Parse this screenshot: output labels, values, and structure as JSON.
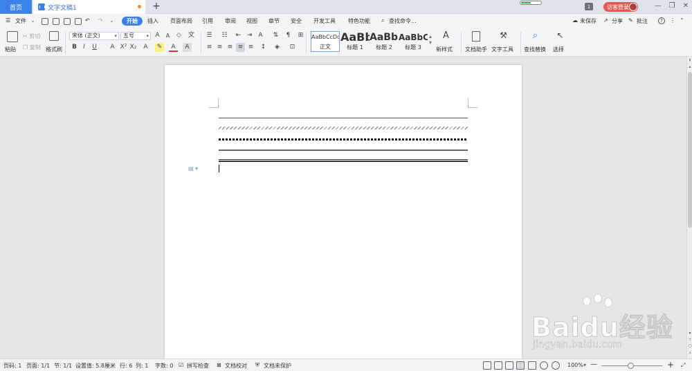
{
  "tabs": {
    "home": "首页",
    "doc": "文字文稿1",
    "add": "+"
  },
  "titlebar": {
    "badge": "1",
    "visitor": "访客登录",
    "minimize": "—",
    "restore": "❐",
    "close": "✕"
  },
  "menu": {
    "file": "文件",
    "items": [
      "开始",
      "插入",
      "页面布局",
      "引用",
      "审阅",
      "视图",
      "章节",
      "安全",
      "开发工具",
      "特色功能"
    ],
    "search": "查找命令...",
    "right": {
      "unsaved": "未保存",
      "share": "分享",
      "comment": "批注",
      "help": "?"
    }
  },
  "ribbon": {
    "paste": "粘贴",
    "cut": "剪切",
    "copy": "复制",
    "format_painter": "格式刷",
    "font": "宋体 (正文)",
    "size": "五号",
    "bold": "B",
    "italic": "I",
    "underline": "U",
    "styles": [
      {
        "preview": "AaBbCcDd",
        "label": "正文"
      },
      {
        "preview": "AaBb",
        "label": "标题 1"
      },
      {
        "preview": "AaBb(",
        "label": "标题 2"
      },
      {
        "preview": "AaBbC(",
        "label": "标题 3"
      }
    ],
    "new_style": "新样式",
    "doc_assist": "文档助手",
    "text_tool": "文字工具",
    "find_replace": "查找替换",
    "select": "选择"
  },
  "status": {
    "page_no": "页码: 1",
    "pages": "页面: 1/1",
    "section": "节: 1/1",
    "setting": "设置值: 5.8厘米",
    "row": "行: 6",
    "col": "列: 1",
    "words": "字数: 0",
    "spell": "拼写检查",
    "proof": "文档校对",
    "protect": "文档未保护",
    "zoom": "100%",
    "minus": "—",
    "plus": "+"
  },
  "watermark": {
    "brand": "Baidu经验",
    "url": "jingyan.baidu.com"
  },
  "colors": {
    "accent": "#3b82e8",
    "visitor": "#e25a52",
    "modified_dot": "#f28b2c"
  }
}
